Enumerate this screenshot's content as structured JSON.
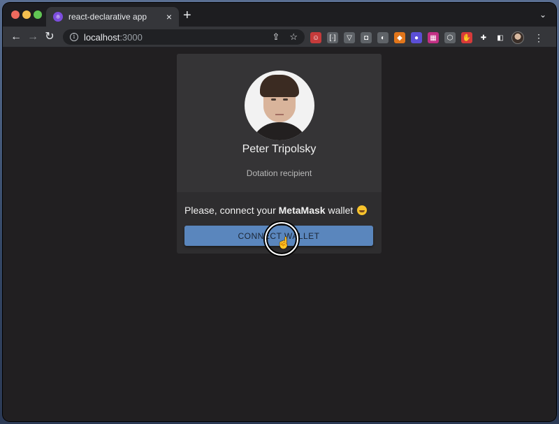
{
  "browser": {
    "tab": {
      "title": "react-declarative app",
      "favicon": "react-favicon-icon"
    },
    "address": {
      "host": "localhost",
      "port": ":3000"
    },
    "nav": {
      "back": "←",
      "forward": "→",
      "reload": "↻"
    },
    "new_tab": "+",
    "tab_close": "×",
    "tab_menu": "⌄",
    "menu": "⋮",
    "extensions": [
      {
        "name": "ext-red-icon",
        "color": "#c53b3b",
        "glyph": "☺"
      },
      {
        "name": "ext-bracket-icon",
        "color": "#5f6368",
        "glyph": "[·]"
      },
      {
        "name": "ext-v-icon",
        "color": "#5f6368",
        "glyph": "▽"
      },
      {
        "name": "ext-camera-icon",
        "color": "#5f6368",
        "glyph": "◘"
      },
      {
        "name": "ext-halfmoon-icon",
        "color": "#5f6368",
        "glyph": "◐"
      },
      {
        "name": "ext-fox-icon",
        "color": "#e2761b",
        "glyph": "◆"
      },
      {
        "name": "ext-blue-icon",
        "color": "#5b4fd6",
        "glyph": "●"
      },
      {
        "name": "ext-pattern-icon",
        "color": "#c22f84",
        "glyph": "▦"
      },
      {
        "name": "ext-cube-icon",
        "color": "#5f6368",
        "glyph": "⬡"
      },
      {
        "name": "ext-hand-icon",
        "color": "#d73a3a",
        "glyph": "✋"
      },
      {
        "name": "extensions-puzzle-icon",
        "color": "#35363a",
        "glyph": "✚"
      },
      {
        "name": "side-panel-icon",
        "color": "#35363a",
        "glyph": "◧"
      }
    ]
  },
  "profile": {
    "name": "Peter Tripolsky",
    "role": "Dotation recipient"
  },
  "connect": {
    "text_before": "Please, connect your ",
    "brand": "MetaMask",
    "text_after": " wallet ",
    "button_label": "CONNECT WALLET"
  },
  "colors": {
    "button": "#5a86bd",
    "page_bg": "#211f21",
    "card_bg": "#2e2d2f"
  }
}
